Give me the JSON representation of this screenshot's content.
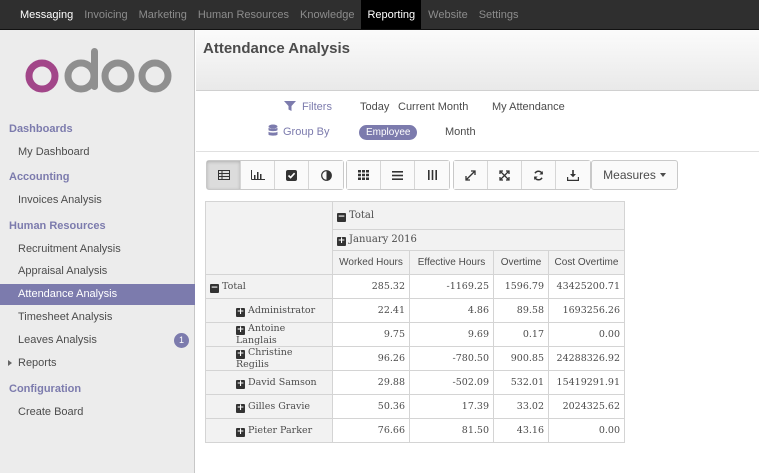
{
  "topnav": {
    "items": [
      "Messaging",
      "Invoicing",
      "Marketing",
      "Human Resources",
      "Knowledge",
      "Reporting",
      "Website",
      "Settings"
    ],
    "active": "Reporting"
  },
  "logo": {
    "text": "odoo"
  },
  "sidebar": {
    "sections": [
      {
        "label": "Dashboards",
        "items": [
          "My Dashboard"
        ]
      },
      {
        "label": "Accounting",
        "items": [
          "Invoices Analysis"
        ]
      },
      {
        "label": "Human Resources",
        "items": [
          "Recruitment Analysis",
          "Appraisal Analysis",
          "Attendance Analysis",
          "Timesheet Analysis",
          "Leaves Analysis",
          "Reports"
        ]
      },
      {
        "label": "Configuration",
        "items": [
          "Create Board"
        ]
      }
    ],
    "active_item": "Attendance Analysis",
    "leaves_badge": "1"
  },
  "page": {
    "title": "Attendance Analysis"
  },
  "search": {
    "filters_label": "Filters",
    "filters": [
      "Today",
      "Current Month",
      "My Attendance"
    ],
    "groupby_label": "Group By",
    "groupby_active": "Employee",
    "groupby_other": "Month"
  },
  "toolbar": {
    "view_buttons": [
      "table-icon",
      "bar-chart-icon",
      "check-icon",
      "pie-icon"
    ],
    "layout_buttons": [
      "grid-icon",
      "list-icon",
      "columns-icon"
    ],
    "action_buttons": [
      "expand-icon",
      "collapse-icon",
      "refresh-icon",
      "download-icon"
    ],
    "measures_label": "Measures"
  },
  "pivot": {
    "col_total": "Total",
    "col_group": "January 2016",
    "headers": [
      "Worked Hours",
      "Effective Hours",
      "Overtime",
      "Cost Overtime"
    ],
    "total_row": {
      "label": "Total",
      "values": [
        "285.32",
        "-1169.25",
        "1596.79",
        "43425200.71"
      ]
    },
    "rows": [
      {
        "label": "Administrator",
        "values": [
          "22.41",
          "4.86",
          "89.58",
          "1693256.26"
        ]
      },
      {
        "label": "Antoine Langlais",
        "values": [
          "9.75",
          "9.69",
          "0.17",
          "0.00"
        ]
      },
      {
        "label": "Christine Regilis",
        "values": [
          "96.26",
          "-780.50",
          "900.85",
          "24288326.92"
        ]
      },
      {
        "label": "David Samson",
        "values": [
          "29.88",
          "-502.09",
          "532.01",
          "15419291.91"
        ]
      },
      {
        "label": "Gilles Gravie",
        "values": [
          "50.36",
          "17.39",
          "33.02",
          "2024325.62"
        ]
      },
      {
        "label": "Pieter Parker",
        "values": [
          "76.66",
          "81.50",
          "43.16",
          "0.00"
        ]
      }
    ]
  },
  "colors": {
    "accent": "#7c7bad",
    "topbar": "#2f2f2f",
    "logo_o": "#a24689",
    "logo_doo": "#8f8f8f"
  }
}
